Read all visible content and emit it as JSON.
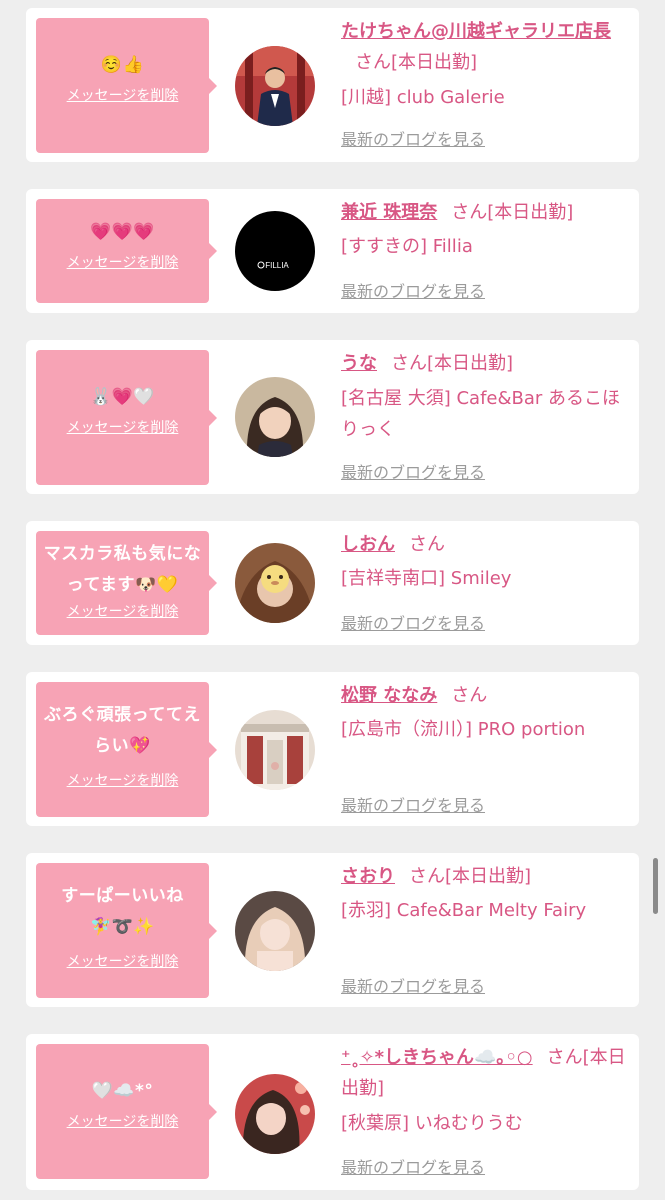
{
  "delete_label": "メッセージを削除",
  "blog_label": "最新のブログを見る",
  "colors": {
    "page_bg": "#eeeeee",
    "bubble": "#f7a3b5",
    "name": "#d85784",
    "blog_link": "#9b9b9b"
  },
  "entries": [
    {
      "message": "☺️👍",
      "name": "たけちゃん@川越ギャラリエ店長",
      "status": "さん[本日出勤]",
      "shop": "[川越] club Galerie",
      "avatar_icon": "man-in-suit-photo"
    },
    {
      "message": "💗💗💗",
      "name": "兼近 珠理奈",
      "status": "さん[本日出勤]",
      "shop": "[すすきの] Fillia",
      "avatar_icon": "fillia-logo",
      "avatar_logo_text": "FILLIA"
    },
    {
      "message": "🐰💗🤍",
      "name": "うな",
      "status": "さん[本日出勤]",
      "shop": "[名古屋 大須] Cafe&Bar あるこほりっく",
      "avatar_icon": "woman-portrait-photo"
    },
    {
      "message": "マスカラ私も気になってます🐶💛",
      "name": "しおん",
      "status": "さん",
      "shop": "[吉祥寺南口] Smiley",
      "avatar_icon": "woman-with-sticker-photo"
    },
    {
      "message": "ぶろぐ頑張っててえらい💖",
      "name": "松野 ななみ",
      "status": "さん",
      "shop": "[広島市（流川）] PRO portion",
      "avatar_icon": "building-photo"
    },
    {
      "message": "すーぱーいいね🧚‍♀️➰✨",
      "name": "さおり",
      "status": "さん[本日出勤]",
      "shop": "[赤羽] Cafe&Bar Melty Fairy",
      "avatar_icon": "woman-blonde-photo"
    },
    {
      "message": "🤍☁️*°",
      "name": "⁺˳✧*しきちゃん☁️｡◦○",
      "status": "さん[本日出勤]",
      "shop": "[秋葉原] いねむりうむ",
      "avatar_icon": "woman-red-lights-photo"
    }
  ]
}
